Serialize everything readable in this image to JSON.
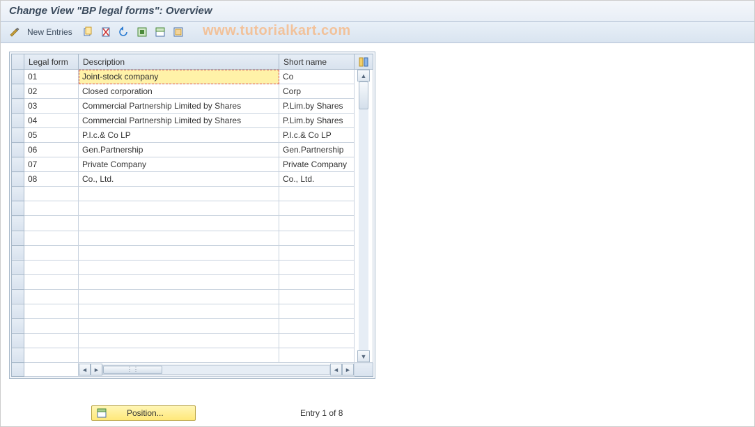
{
  "title": "Change View \"BP legal forms\": Overview",
  "watermark": "www.tutorialkart.com",
  "toolbar": {
    "new_entries": "New Entries",
    "icons": {
      "change": "change-display-icon",
      "copy": "copy-icon",
      "delete": "delete-icon",
      "undo": "undo-icon",
      "select_all": "select-all-icon",
      "select_block": "select-block-icon",
      "deselect": "deselect-all-icon"
    }
  },
  "columns": {
    "legal_form": "Legal form",
    "description": "Description",
    "short_name": "Short name"
  },
  "rows": [
    {
      "legal": "01",
      "desc": "Joint-stock company",
      "short": "Co",
      "selected": true
    },
    {
      "legal": "02",
      "desc": "Closed corporation",
      "short": "Corp"
    },
    {
      "legal": "03",
      "desc": "Commercial Partnership Limited by Shares",
      "short": "P.Lim.by Shares"
    },
    {
      "legal": "04",
      "desc": "Commercial Partnership Limited by Shares",
      "short": "P.Lim.by Shares"
    },
    {
      "legal": "05",
      "desc": "P.l.c.& Co LP",
      "short": "P.l.c.& Co LP"
    },
    {
      "legal": "06",
      "desc": "Gen.Partnership",
      "short": "Gen.Partnership"
    },
    {
      "legal": "07",
      "desc": "Private Company",
      "short": "Private Company"
    },
    {
      "legal": "08",
      "desc": "Co., Ltd.",
      "short": "Co., Ltd."
    }
  ],
  "empty_rows": 12,
  "footer": {
    "position_label": "Position...",
    "entry_text": "Entry 1 of 8"
  }
}
